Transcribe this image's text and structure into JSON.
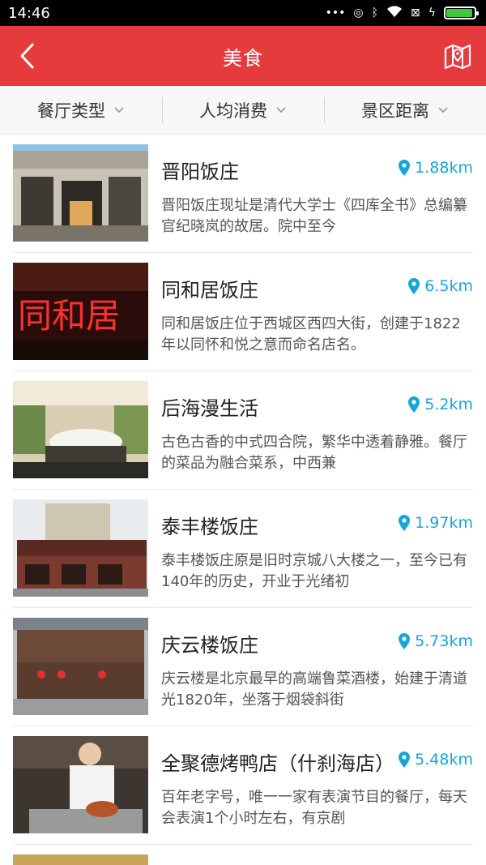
{
  "status": {
    "time": "14:46"
  },
  "header": {
    "title": "美食",
    "back_icon": "back-arrow-icon",
    "map_icon": "map-icon"
  },
  "filters": [
    {
      "label": "餐厅类型"
    },
    {
      "label": "人均消费"
    },
    {
      "label": "景区距离"
    }
  ],
  "restaurants": [
    {
      "name": "晋阳饭庄",
      "distance": "1.88km",
      "description": "晋阳饭庄现址是清代大学士《四库全书》总编纂官纪晓岚的故居。院中至今"
    },
    {
      "name": "同和居饭庄",
      "distance": "6.5km",
      "description": "同和居饭庄位于西城区西四大街，创建于1822年以同怀和悦之意而命名店名。"
    },
    {
      "name": "后海漫生活",
      "distance": "5.2km",
      "description": "古色古香的中式四合院，繁华中透着静雅。餐厅的菜品为融合菜系，中西兼"
    },
    {
      "name": "泰丰楼饭庄",
      "distance": "1.97km",
      "description": "泰丰楼饭庄原是旧时京城八大楼之一，至今已有140年的历史，开业于光绪初"
    },
    {
      "name": "庆云楼饭庄",
      "distance": "5.73km",
      "description": "庆云楼是北京最早的高端鲁菜酒楼，始建于清道光1820年，坐落于烟袋斜街"
    },
    {
      "name": "全聚德烤鸭店（什刹海店）",
      "distance": "5.48km",
      "description": "百年老字号，唯一一家有表演节目的餐厅，每天会表演1个小时左右，有京剧"
    }
  ],
  "thumb_texts": {
    "tonghe_sign": "同和居"
  },
  "colors": {
    "accent": "#e63b3d",
    "distance": "#19a4d9"
  }
}
